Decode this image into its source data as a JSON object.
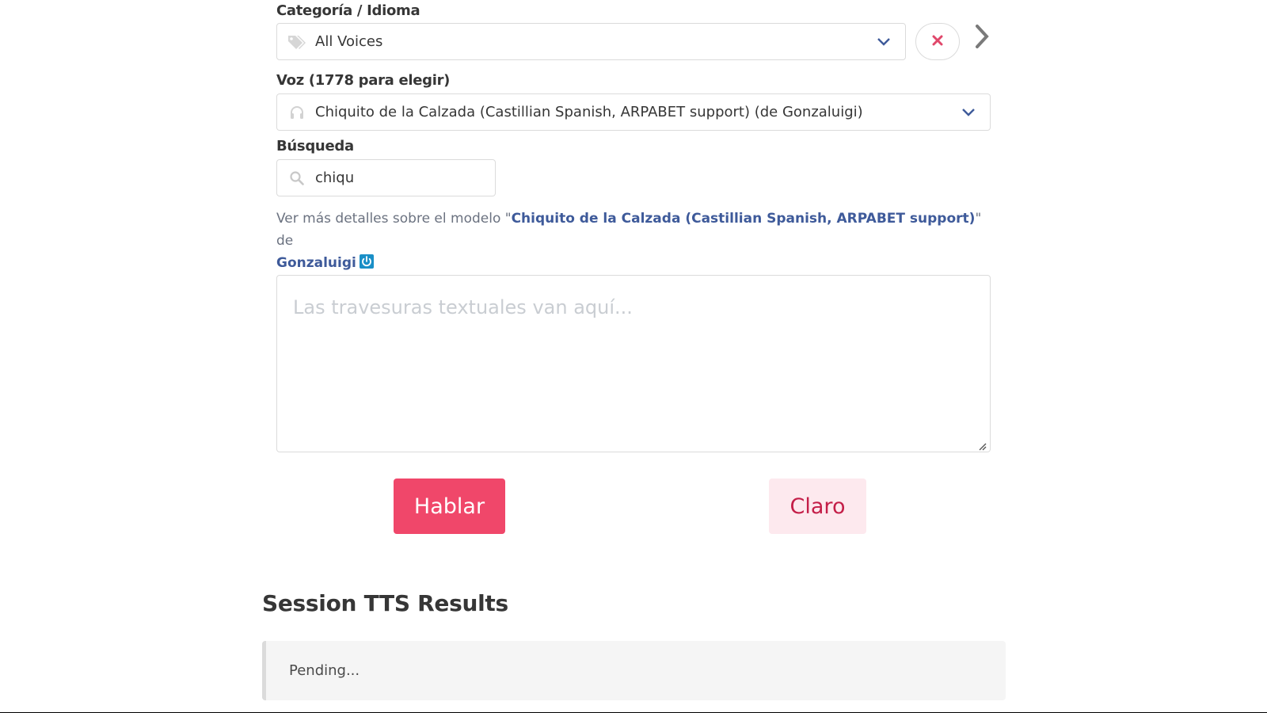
{
  "category": {
    "label": "Categoría / Idioma",
    "selected": "All Voices",
    "icon": "tags-icon"
  },
  "voice": {
    "label": "Voz (1778 para elegir)",
    "selected": "Chiquito de la Calzada (Castillian Spanish, ARPABET support) (de Gonzaluigi)",
    "icon": "headphones-icon"
  },
  "search": {
    "label": "Búsqueda",
    "value": "chiqu",
    "icon": "search-icon"
  },
  "details": {
    "prefix": "Ver más detalles sobre el modelo \"",
    "model_link": "Chiquito de la Calzada (Castillian Spanish, ARPABET support)",
    "middle": "\" de",
    "author_link": "Gonzaluigi"
  },
  "text_input": {
    "placeholder": "Las travesuras textuales van aquí..."
  },
  "buttons": {
    "speak": "Hablar",
    "clear": "Claro"
  },
  "results": {
    "title": "Session TTS Results",
    "status": "Pending..."
  },
  "colors": {
    "primary": "#f0476a",
    "primary_light": "#fde9ee",
    "link": "#3e5a9a",
    "clear_x": "#e0476a"
  }
}
